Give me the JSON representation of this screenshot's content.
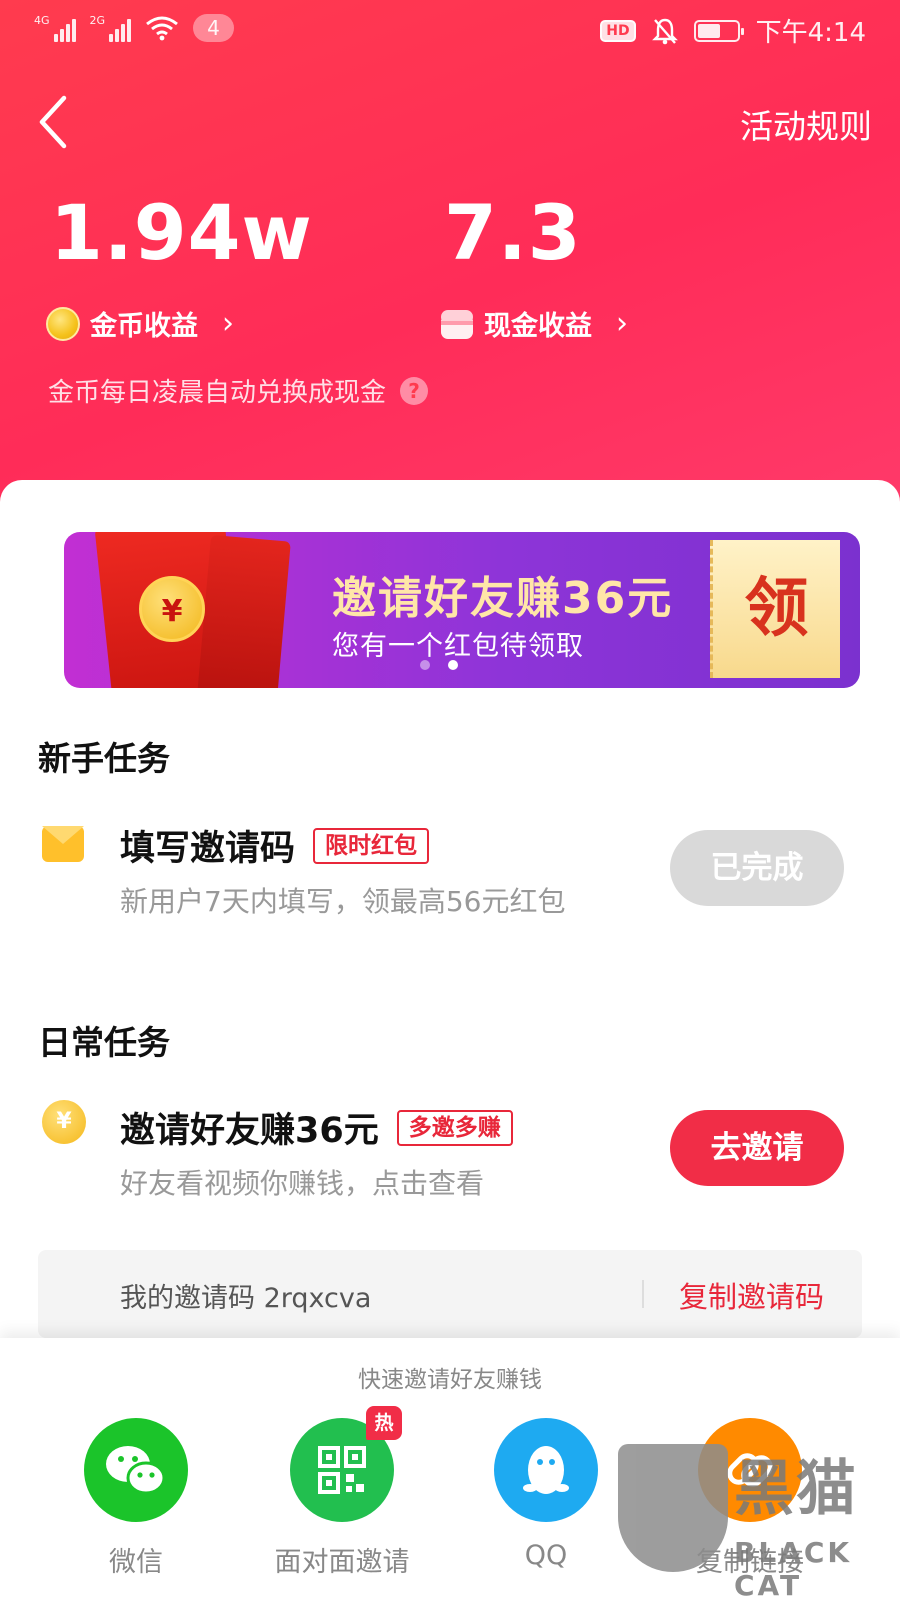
{
  "status_bar": {
    "network_1": "4G",
    "network_2": "2G",
    "notification_count": "4",
    "hd_label": "HD",
    "time": "下午4:14"
  },
  "header": {
    "back_icon": "back-arrow-icon",
    "rules_label": "活动规则",
    "coin_value": "1.94w",
    "coin_label": "金币收益",
    "cash_value": "7.3",
    "cash_label": "现金收益",
    "note": "金币每日凌晨自动兑换成现金",
    "chevron": "›",
    "help_glyph": "?",
    "background_color": "#ff2c58"
  },
  "banner": {
    "title": "邀请好友赚36元",
    "subtitle": "您有一个红包待领取",
    "claim_label": "领",
    "coin_glyph": "¥",
    "page_count": 2,
    "active_page": 2
  },
  "newbie": {
    "section_title": "新手任务",
    "task_title": "填写邀请码",
    "task_tag": "限时红包",
    "task_desc": "新用户7天内填写，领最高56元红包",
    "button_label": "已完成",
    "icon": "envelope-icon"
  },
  "daily": {
    "section_title": "日常任务",
    "task_title": "邀请好友赚36元",
    "task_tag": "多邀多赚",
    "task_desc": "好友看视频你赚钱，点击查看",
    "button_label": "去邀请",
    "icon_glyph": "¥",
    "invite_code_text": "我的邀请码 2rqxcva",
    "copy_label": "复制邀请码"
  },
  "share": {
    "title": "快速邀请好友赚钱",
    "items": [
      {
        "label": "微信",
        "icon": "wechat-icon",
        "color": "#1bc42a"
      },
      {
        "label": "面对面邀请",
        "icon": "qr-code-icon",
        "color": "#22bf4f",
        "badge": "热"
      },
      {
        "label": "QQ",
        "icon": "qq-penguin-icon",
        "color": "#1eaaf1"
      },
      {
        "label": "复制链接",
        "icon": "link-icon",
        "color": "#ff8a00"
      }
    ]
  },
  "watermark": {
    "cn": "黑猫",
    "en": "BLACK CAT"
  },
  "colors": {
    "accent": "#f12d47",
    "tag_red": "#e8273a",
    "done_gray": "#d9d9d9"
  }
}
